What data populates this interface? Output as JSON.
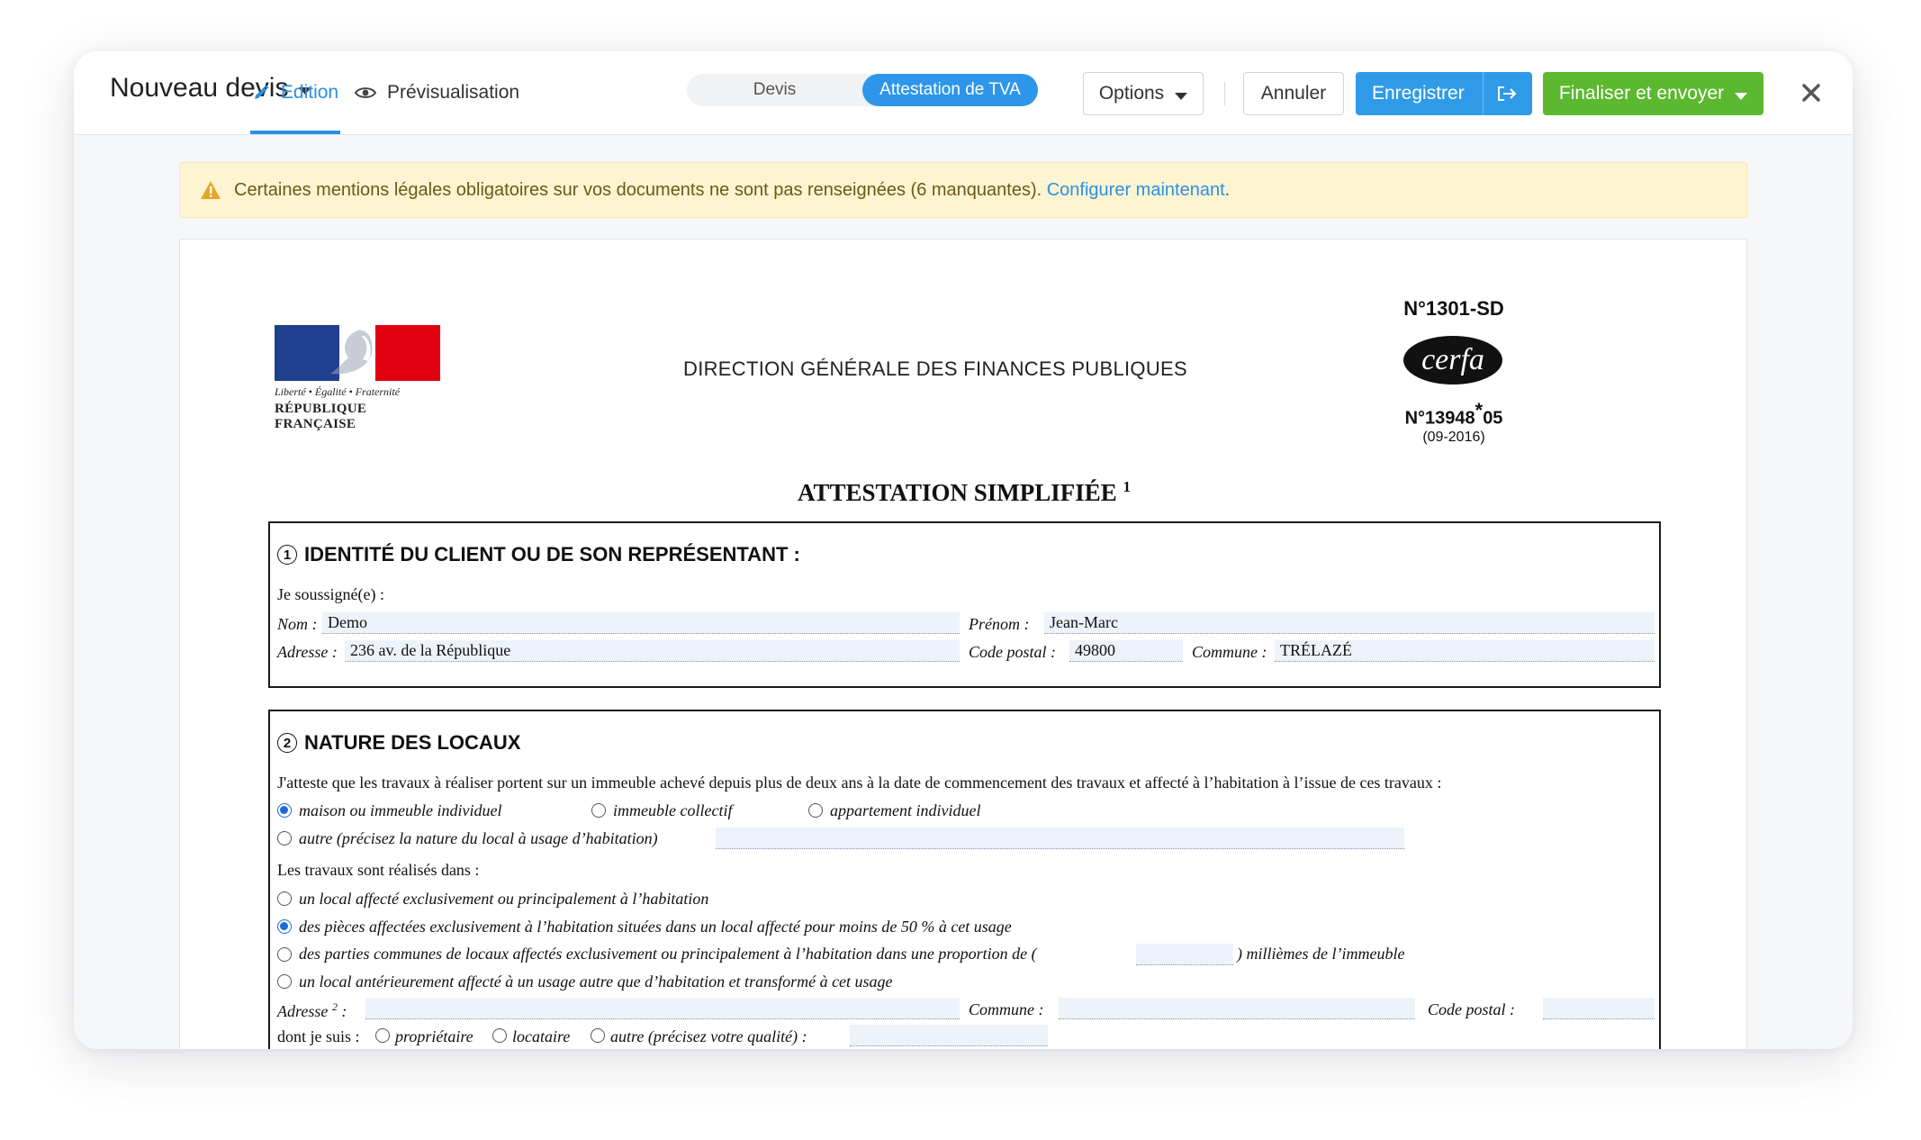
{
  "header": {
    "title": "Nouveau devis",
    "tabs": [
      {
        "label": "Edition",
        "icon": "pencil-icon",
        "active": true
      },
      {
        "label": "Prévisualisation",
        "icon": "eye-icon",
        "active": false
      }
    ],
    "segments": [
      {
        "label": "Devis",
        "selected": false
      },
      {
        "label": "Attestation de TVA",
        "selected": true
      }
    ],
    "buttons": {
      "options": "Options",
      "cancel": "Annuler",
      "save": "Enregistrer",
      "finalize": "Finaliser et envoyer"
    },
    "colors": {
      "accent": "#2a90e6",
      "save": "#2f9be8",
      "finalize": "#5cb82f"
    }
  },
  "alert": {
    "text": "Certaines mentions légales obligatoires sur vos documents ne sont pas renseignées (6 manquantes).",
    "link": "Configurer maintenant",
    "after": "."
  },
  "document": {
    "logo_line1": "Liberté • Égalité • Fraternité",
    "logo_line2": "RÉPUBLIQUE FRANÇAISE",
    "direction": "DIRECTION GÉNÉRALE DES FINANCES PUBLIQUES",
    "cerfa_number": "N°1301-SD",
    "cerfa_logo": "cerfa",
    "cerfa_code": "N°13948",
    "cerfa_star": "*",
    "cerfa_suffix": "05",
    "cerfa_date": "(09-2016)",
    "title": "ATTESTATION SIMPLIFIÉE",
    "title_note": "1",
    "section1": {
      "num": "1",
      "title": "IDENTITÉ DU CLIENT OU DE SON REPRÉSENTANT :",
      "intro": "Je soussigné(e) :",
      "nom_label": "Nom :",
      "nom_value": "Demo",
      "prenom_label": "Prénom :",
      "prenom_value": "Jean-Marc",
      "adresse_label": "Adresse :",
      "adresse_value": "236 av. de la République",
      "cp_label": "Code postal :",
      "cp_value": "49800",
      "commune_label": "Commune :",
      "commune_value": "TRÉLAZÉ"
    },
    "section2": {
      "num": "2",
      "title": "NATURE DES LOCAUX",
      "intro": "J'atteste que les travaux à réaliser portent sur un immeuble achevé depuis plus de deux ans à la date de commencement des travaux et affecté à l’habitation à l’issue de ces travaux :",
      "type_options": [
        {
          "label": "maison ou immeuble individuel",
          "checked": true
        },
        {
          "label": "immeuble collectif",
          "checked": false
        },
        {
          "label": "appartement individuel",
          "checked": false
        }
      ],
      "autre_label": "autre (précisez la nature du local à usage d’habitation)",
      "travaux_intro": "Les travaux sont réalisés dans :",
      "travaux_options": [
        {
          "label": "un local affecté exclusivement ou principalement à l’habitation",
          "checked": false
        },
        {
          "label": "des pièces affectées exclusivement à l’habitation situées dans un local affecté pour moins de 50 % à cet usage",
          "checked": true
        },
        {
          "label": "des parties communes de locaux affectés exclusivement ou principalement à l’habitation dans une proportion de (",
          "checked": false
        },
        {
          "label": "un local antérieurement affecté à un usage autre que d’habitation et transformé à cet usage",
          "checked": false
        }
      ],
      "milliemes_suffix": ") millièmes de l’immeuble",
      "adresse_label": "Adresse",
      "adresse_note": "2",
      "adresse_colon": ":",
      "commune_label": "Commune :",
      "cp_label": "Code postal :",
      "dont_label": "dont je suis :",
      "qualite_options": [
        {
          "label": "propriétaire",
          "checked": false
        },
        {
          "label": "locataire",
          "checked": false
        },
        {
          "label": "autre (précisez votre qualité) :",
          "checked": false
        }
      ]
    }
  }
}
